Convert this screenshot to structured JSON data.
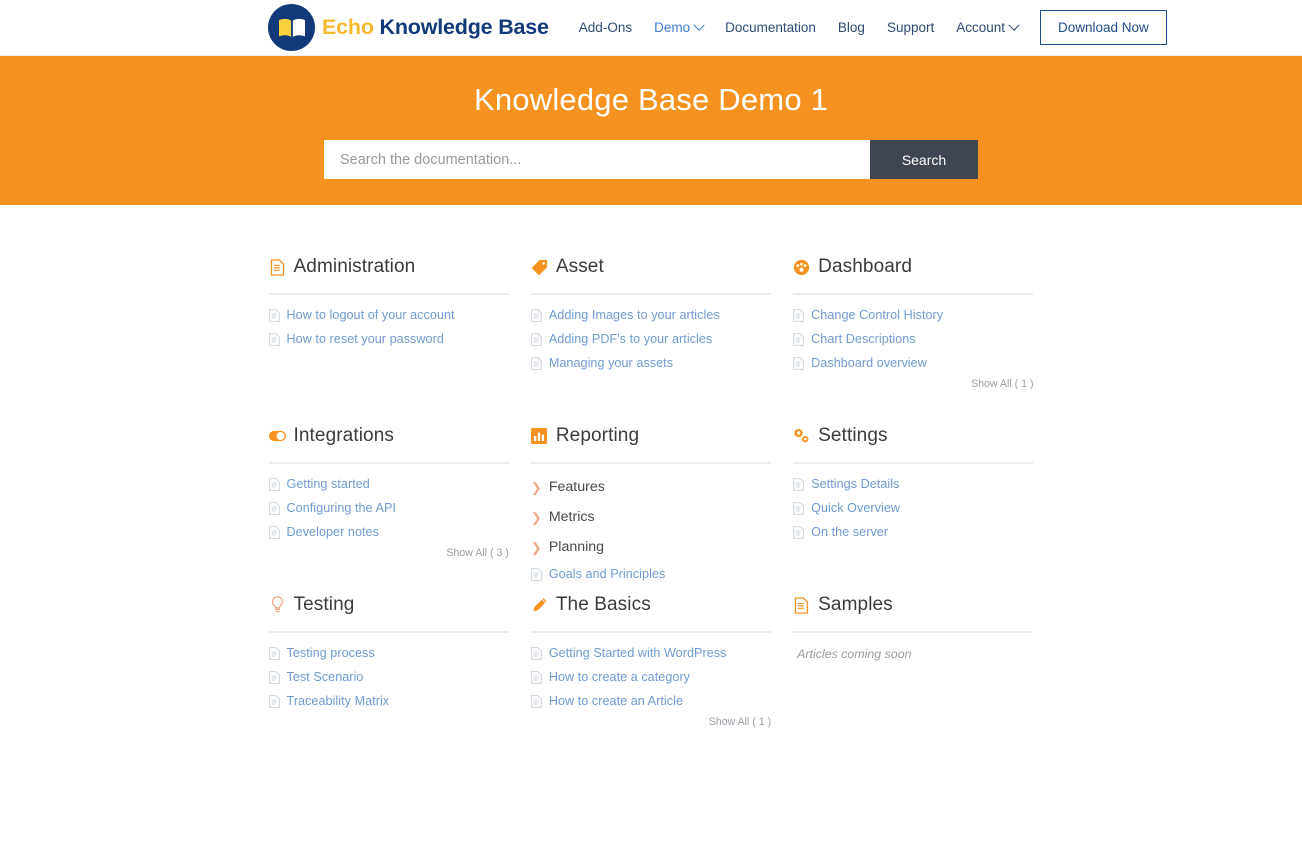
{
  "header": {
    "logo": {
      "icon": "open-book-logo-icon",
      "text_part1": "Echo",
      "text_part2": "Knowledge Base"
    },
    "nav_items": [
      {
        "label": "Add-Ons",
        "has_caret": false,
        "active": false
      },
      {
        "label": "Demo",
        "has_caret": true,
        "active": true
      },
      {
        "label": "Documentation",
        "has_caret": false,
        "active": false
      },
      {
        "label": "Blog",
        "has_caret": false,
        "active": false
      },
      {
        "label": "Support",
        "has_caret": false,
        "active": false
      },
      {
        "label": "Account",
        "has_caret": true,
        "active": false
      }
    ],
    "download_label": "Download Now"
  },
  "hero": {
    "title": "Knowledge Base Demo 1",
    "background_color": "#f6921f",
    "search": {
      "placeholder": "Search the documentation...",
      "value": "",
      "button_label": "Search",
      "button_color": "#3f4551"
    }
  },
  "categories": [
    {
      "title": "Administration",
      "icon": "document-icon",
      "articles": [
        {
          "label": "How to logout of your account"
        },
        {
          "label": "How to reset your password"
        }
      ],
      "subcategories": [],
      "show_all": null,
      "empty_note": null
    },
    {
      "title": "Asset",
      "icon": "tag-icon",
      "articles": [
        {
          "label": "Adding Images to your articles"
        },
        {
          "label": "Adding PDF's to your articles"
        },
        {
          "label": "Managing your assets"
        }
      ],
      "subcategories": [],
      "show_all": null,
      "empty_note": null
    },
    {
      "title": "Dashboard",
      "icon": "gauge-icon",
      "articles": [
        {
          "label": "Change Control History"
        },
        {
          "label": "Chart Descriptions"
        },
        {
          "label": "Dashboard overview"
        }
      ],
      "subcategories": [],
      "show_all": "Show All ( 1 )",
      "empty_note": null
    },
    {
      "title": "Integrations",
      "icon": "toggle-switch-icon",
      "articles": [
        {
          "label": "Getting started"
        },
        {
          "label": "Configuring the API"
        },
        {
          "label": "Developer notes"
        }
      ],
      "subcategories": [],
      "show_all": "Show All ( 3 )",
      "empty_note": null
    },
    {
      "title": "Reporting",
      "icon": "bar-chart-icon",
      "articles": [
        {
          "label": "Goals and Principles"
        }
      ],
      "subcategories": [
        {
          "label": "Features"
        },
        {
          "label": "Metrics"
        },
        {
          "label": "Planning"
        }
      ],
      "show_all": null,
      "empty_note": null
    },
    {
      "title": "Settings",
      "icon": "gears-icon",
      "articles": [
        {
          "label": "Settings Details"
        },
        {
          "label": "Quick Overview"
        },
        {
          "label": "On the server"
        }
      ],
      "subcategories": [],
      "show_all": null,
      "empty_note": null
    },
    {
      "title": "Testing",
      "icon": "lightbulb-icon",
      "articles": [
        {
          "label": "Testing process"
        },
        {
          "label": "Test Scenario"
        },
        {
          "label": "Traceability Matrix"
        }
      ],
      "subcategories": [],
      "show_all": null,
      "empty_note": null
    },
    {
      "title": "The Basics",
      "icon": "pencil-icon",
      "articles": [
        {
          "label": "Getting Started with WordPress"
        },
        {
          "label": "How to create a category"
        },
        {
          "label": "How to create an Article"
        }
      ],
      "subcategories": [],
      "show_all": "Show All ( 1 )",
      "empty_note": null
    },
    {
      "title": "Samples",
      "icon": "document-icon",
      "articles": [],
      "subcategories": [],
      "show_all": null,
      "empty_note": "Articles coming soon"
    }
  ],
  "colors": {
    "accent_orange": "#f6921f",
    "brand_navy": "#12397a",
    "brand_yellow": "#f7b82e",
    "link_blue": "#6f9bd1",
    "nav_blue": "#3d7edb"
  }
}
